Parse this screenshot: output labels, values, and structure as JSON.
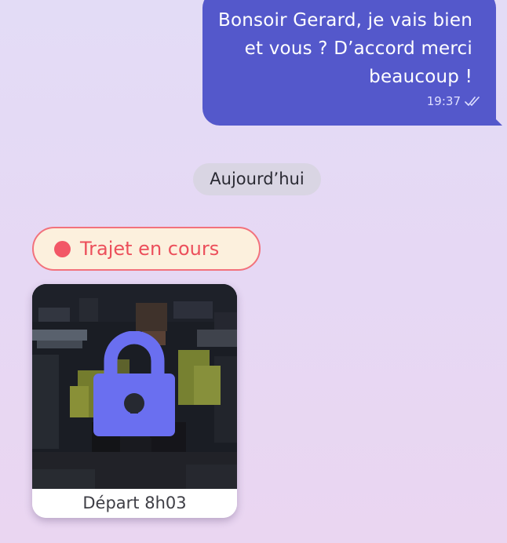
{
  "message_out": {
    "text": "Bonsoir Gerard, je vais bien et vous ? D’accord merci beaucoup !",
    "time": "19:37",
    "status_icon": "double-check-icon"
  },
  "date_separator": {
    "label": "Aujourd’hui"
  },
  "trip_status": {
    "label": "Trajet en cours",
    "dot_color": "#f25767"
  },
  "photo_card": {
    "caption": "Départ 8h03",
    "overlay_icon": "lock-icon",
    "accent_color": "#6a6ff0"
  },
  "colors": {
    "bubble_out": "#5458cb",
    "trip_border": "#f2727c",
    "trip_background": "#fcf0dd"
  }
}
